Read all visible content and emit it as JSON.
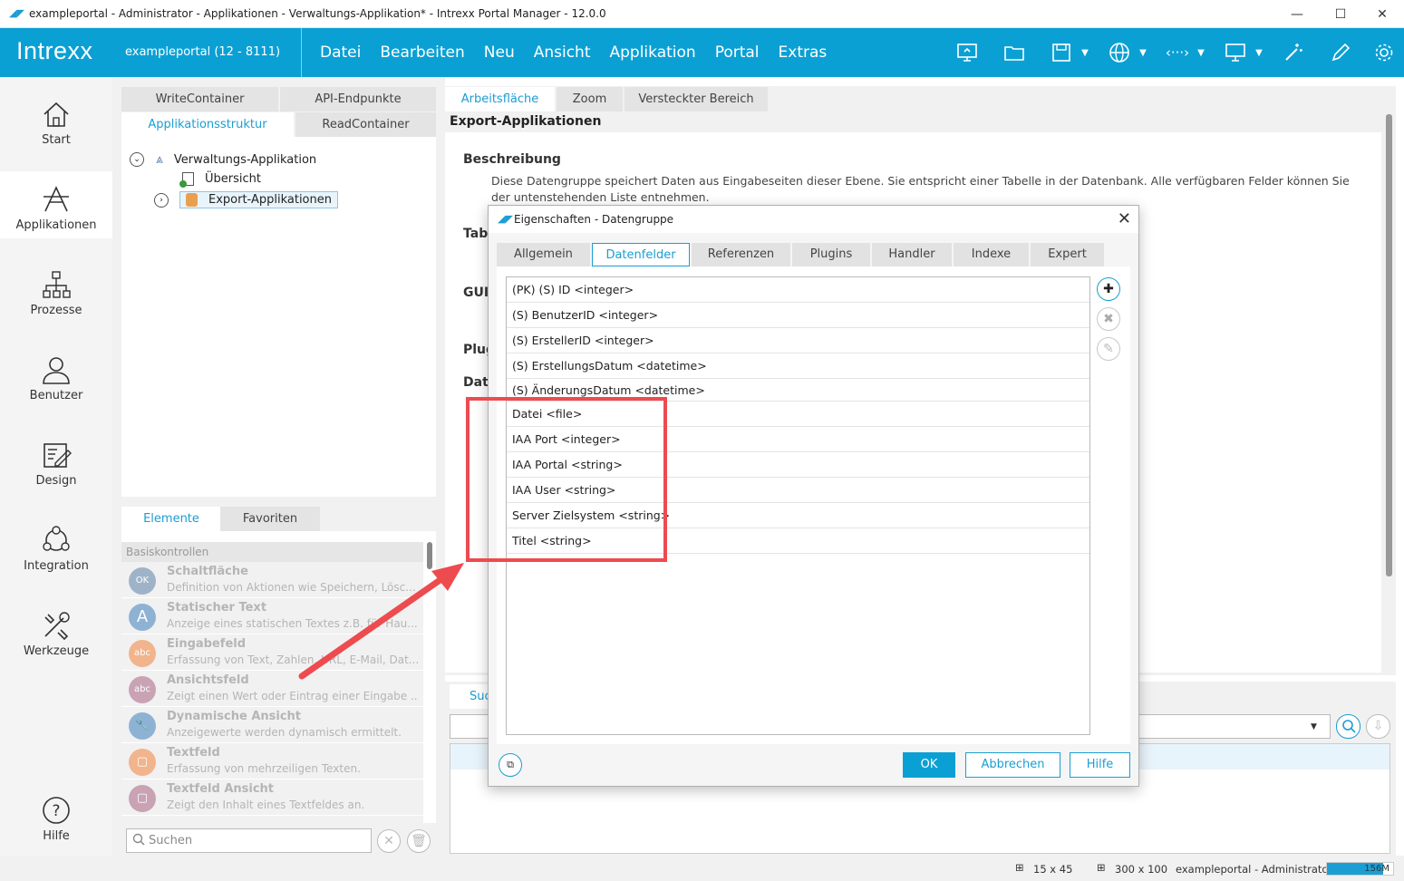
{
  "window": {
    "title": "exampleportal - Administrator - Applikationen - Verwaltungs-Applikation* - Intrexx Portal Manager - 12.0.0",
    "minimize": "—",
    "maximize": "☐",
    "close": "✕"
  },
  "header": {
    "logo": "Intrexx",
    "portal": "exampleportal (12 - 8111)",
    "menu": [
      "Datei",
      "Bearbeiten",
      "Neu",
      "Ansicht",
      "Applikation",
      "Portal",
      "Extras"
    ]
  },
  "leftnav": {
    "items": [
      {
        "label": "Start",
        "icon": "home-icon"
      },
      {
        "label": "Applikationen",
        "icon": "applications-icon"
      },
      {
        "label": "Prozesse",
        "icon": "processes-icon"
      },
      {
        "label": "Benutzer",
        "icon": "user-icon"
      },
      {
        "label": "Design",
        "icon": "design-icon"
      },
      {
        "label": "Integration",
        "icon": "integration-icon"
      },
      {
        "label": "Werkzeuge",
        "icon": "tools-icon"
      }
    ],
    "help": "Hilfe"
  },
  "structure_tabs": {
    "row1": [
      "WriteContainer",
      "API-Endpunkte"
    ],
    "row2": [
      "Applikationsstruktur",
      "ReadContainer"
    ]
  },
  "tree": {
    "root": "Verwaltungs-Applikation",
    "child1": "Übersicht",
    "child2": "Export-Applikationen"
  },
  "elements_panel": {
    "tabs": [
      "Elemente",
      "Favoriten"
    ],
    "group": "Basiskontrollen",
    "items": [
      {
        "title": "Schaltfläche",
        "desc": "Definition von Aktionen wie Speichern, Lösc...",
        "icon_text": "OK",
        "color": "#9fb3c8"
      },
      {
        "title": "Statischer Text",
        "desc": "Anzeige eines statischen Textes z.B. für Hau...",
        "icon_text": "A",
        "color": "#8eb2d3"
      },
      {
        "title": "Eingabefeld",
        "desc": "Erfassung von Text, Zahlen, URL, E-Mail, Dat...",
        "icon_text": "abc",
        "color": "#f2b48c"
      },
      {
        "title": "Ansichtsfeld",
        "desc": "Zeigt einen Wert oder Eintrag einer Eingabe ...",
        "icon_text": "abc",
        "color": "#c9a3b3"
      },
      {
        "title": "Dynamische Ansicht",
        "desc": "Anzeigewerte werden dynamisch ermittelt.",
        "icon_text": "🔧",
        "color": "#8eb2d3"
      },
      {
        "title": "Textfeld",
        "desc": "Erfassung von mehrzeiligen Texten.",
        "icon_text": "▢",
        "color": "#f2b48c"
      },
      {
        "title": "Textfeld Ansicht",
        "desc": "Zeigt den Inhalt eines Textfeldes an.",
        "icon_text": "▢",
        "color": "#c9a3b3"
      }
    ],
    "search_placeholder": "Suchen"
  },
  "work_tabs": [
    "Arbeitsfläche",
    "Zoom",
    "Versteckter Bereich"
  ],
  "work": {
    "crumb": "Export-Applikationen",
    "section_desc": "Beschreibung",
    "desc_text": "Diese Datengruppe speichert Daten aus Eingabeseiten dieser Ebene. Sie entspricht einer Tabelle in der Datenbank. Alle verfügbaren Felder können Sie der untenstehenden Liste entnehmen.",
    "cut_labels": [
      "Tab",
      "GUI",
      "Plug",
      "Dat"
    ]
  },
  "bottom": {
    "tab": "Suc"
  },
  "dialog": {
    "title": "Eigenschaften - Datengruppe",
    "tabs": [
      "Allgemein",
      "Datenfelder",
      "Referenzen",
      "Plugins",
      "Handler",
      "Indexe",
      "Expert"
    ],
    "fields": [
      "(PK) (S) ID <integer>",
      "(S) BenutzerID <integer>",
      "(S) ErstellerID <integer>",
      "(S) ErstellungsDatum <datetime>",
      "(S) ÄnderungsDatum <datetime>",
      "Datei <file>",
      "IAA Port <integer>",
      "IAA Portal <string>",
      "IAA User <string>",
      "Server Zielsystem <string>",
      "Titel <string>"
    ],
    "buttons": {
      "ok": "OK",
      "cancel": "Abbrechen",
      "help": "Hilfe"
    }
  },
  "statusbar": {
    "grid": "15 x 45",
    "size": "300 x 100",
    "user": "exampleportal - Administrator",
    "memory": "156M",
    "memory_fraction": 0.85
  },
  "colors": {
    "brand": "#0ba0d4",
    "accent_text": "#1b9ed3",
    "annotation": "#ee4b4f"
  }
}
